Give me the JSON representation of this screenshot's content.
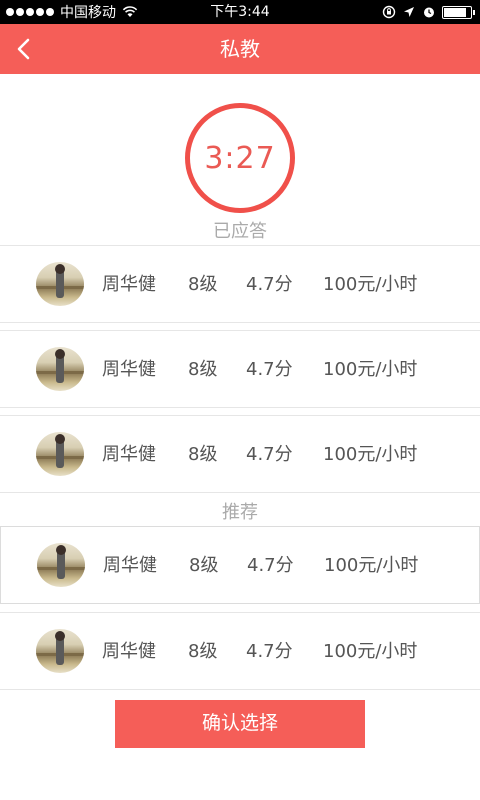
{
  "status_bar": {
    "carrier": "中国移动",
    "time": "下午3:44"
  },
  "header": {
    "title": "私教",
    "back_icon": "chevron-left-icon"
  },
  "timer": {
    "value": "3:27"
  },
  "sections": {
    "answered_label": "已应答",
    "recommended_label": "推荐"
  },
  "answered_coaches": [
    {
      "name": "周华健",
      "level": "8级",
      "score": "4.7分",
      "price": "100元/小时"
    },
    {
      "name": "周华健",
      "level": "8级",
      "score": "4.7分",
      "price": "100元/小时"
    },
    {
      "name": "周华健",
      "level": "8级",
      "score": "4.7分",
      "price": "100元/小时"
    }
  ],
  "recommended_coaches": [
    {
      "name": "周华健",
      "level": "8级",
      "score": "4.7分",
      "price": "100元/小时"
    },
    {
      "name": "周华健",
      "level": "8级",
      "score": "4.7分",
      "price": "100元/小时"
    }
  ],
  "confirm_button": {
    "label": "确认选择"
  },
  "colors": {
    "accent": "#f55e58",
    "timer": "#ea5a54",
    "muted_text": "#aaaaaa"
  }
}
